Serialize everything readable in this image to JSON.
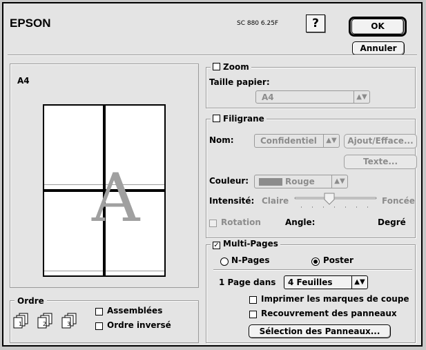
{
  "header": {
    "brand": "EPSON",
    "version": "SC 880 6.25F",
    "help_label": "?",
    "ok_label": "OK",
    "cancel_label": "Annuler"
  },
  "preview": {
    "paper_label": "A4",
    "watermark_letter": "A"
  },
  "order": {
    "title": "Ordre",
    "collated_label": "Assemblées",
    "reverse_label": "Ordre inversé",
    "icon_numbers": [
      "1",
      "2",
      "3"
    ]
  },
  "zoom": {
    "title": "Zoom",
    "checked": false,
    "paper_size_label": "Taille papier:",
    "paper_size_value": "A4"
  },
  "watermark": {
    "title": "Filigrane",
    "checked": false,
    "name_label": "Nom:",
    "name_value": "Confidentiel",
    "add_remove_label": "Ajout/Efface...",
    "text_label": "Texte...",
    "color_label": "Couleur:",
    "color_value": "Rouge",
    "color_swatch": "#8c8c8c",
    "intensity_label": "Intensité:",
    "light_label": "Claire",
    "dark_label": "Foncée",
    "rotation_label": "Rotation",
    "angle_label": "Angle:",
    "degree_label": "Degré"
  },
  "multipage": {
    "title": "Multi-Pages",
    "checked": true,
    "npages_label": "N-Pages",
    "poster_label": "Poster",
    "selected": "Poster",
    "page_in_label": "1 Page dans",
    "sheets_value": "4 Feuilles",
    "crop_marks_label": "Imprimer les marques de coupe",
    "overlap_label": "Recouvrement des panneaux",
    "panel_select_label": "Sélection des Panneaux..."
  }
}
